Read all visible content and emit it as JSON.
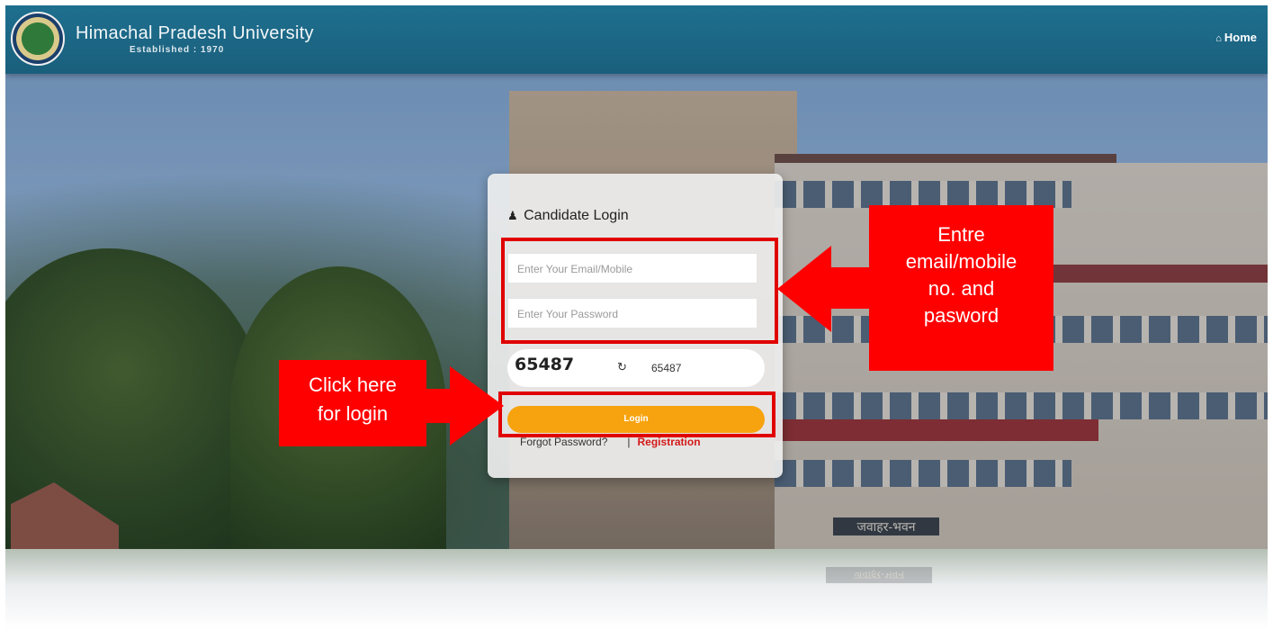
{
  "header": {
    "title": "Himachal Pradesh University",
    "subtitle": "Established : 1970",
    "home_label": "Home"
  },
  "login": {
    "title": "Candidate Login",
    "email_placeholder": "Enter Your Email/Mobile",
    "password_placeholder": "Enter Your Password",
    "captcha_code": "65487",
    "captcha_value": "65487",
    "login_label": "Login",
    "forgot_label": "Forgot Password?",
    "separator": "|",
    "register_label": "Registration"
  },
  "building": {
    "plaque_text": "जवाहर-भवन"
  },
  "annotations": {
    "entry_note": [
      "Entre",
      "email/mobile",
      "no. and",
      "pasword"
    ],
    "login_note": [
      "Click here",
      "for login"
    ]
  },
  "colors": {
    "header_bg": "#1e6f8f",
    "login_button": "#f7a30f",
    "register_link": "#d41919",
    "annotation_red": "#ff0000"
  },
  "icons": {
    "home": "home-icon",
    "user": "user-icon",
    "refresh": "refresh-icon"
  }
}
